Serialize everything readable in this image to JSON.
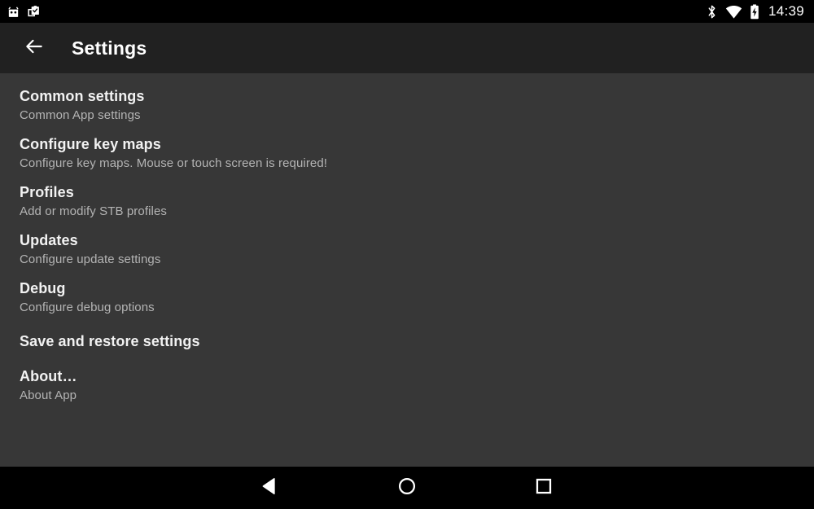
{
  "status_bar": {
    "left_icons": [
      {
        "name": "robot-notification-icon"
      },
      {
        "name": "clipboard-check-icon"
      }
    ],
    "right_icons": [
      {
        "name": "bluetooth-icon"
      },
      {
        "name": "wifi-icon"
      },
      {
        "name": "battery-charging-icon"
      }
    ],
    "time": "14:39",
    "background_color": "#000000"
  },
  "app_bar": {
    "back_label": "back-arrow",
    "title": "Settings",
    "background_color": "#212121"
  },
  "content": {
    "background_color": "#373737",
    "items": [
      {
        "title": "Common settings",
        "summary": "Common App settings"
      },
      {
        "title": "Configure key maps",
        "summary": "Configure key maps. Mouse or touch screen is required!"
      },
      {
        "title": "Profiles",
        "summary": "Add or modify STB profiles"
      },
      {
        "title": "Updates",
        "summary": "Configure update settings"
      },
      {
        "title": "Debug",
        "summary": "Configure debug options"
      },
      {
        "title": "Save and restore settings",
        "summary": ""
      },
      {
        "title": "About…",
        "summary": "About App"
      }
    ]
  },
  "nav_bar": {
    "background_color": "#000000",
    "buttons": [
      {
        "name": "back-triangle-icon"
      },
      {
        "name": "home-circle-icon"
      },
      {
        "name": "recents-square-icon"
      }
    ]
  }
}
